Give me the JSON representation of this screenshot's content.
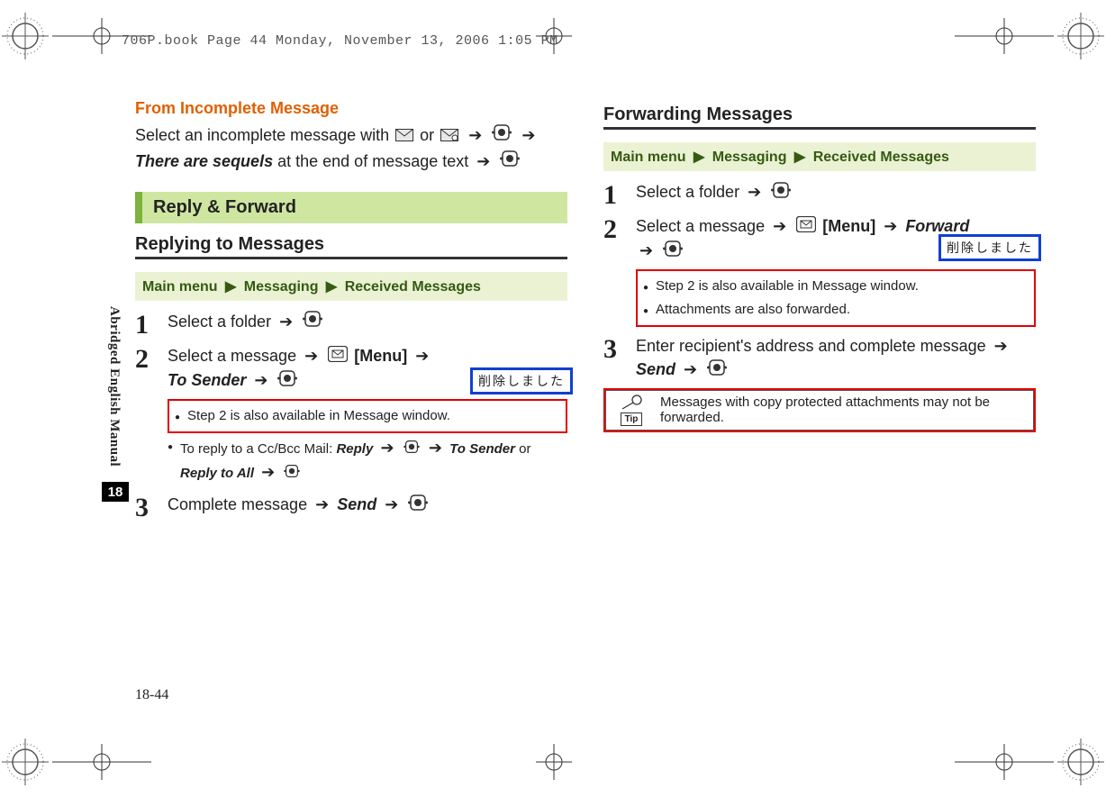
{
  "print_header": "706P.book  Page 44  Monday, November 13, 2006  1:05 PM",
  "sidebar": {
    "label": "Abridged English Manual",
    "chapter": "18",
    "page_num": "18-44"
  },
  "left": {
    "orange_head": "From Incomplete Message",
    "intro_p1a": "Select an incomplete message with ",
    "intro_p1b": " or ",
    "intro_p1c": " ",
    "intro_seq": "There are sequels",
    "intro_tail": " at the end of message text ",
    "greenbar": "Reply & Forward",
    "subhead": "Replying to Messages",
    "crumb": {
      "a": "Main menu",
      "b": "Messaging",
      "c": "Received Messages"
    },
    "step1": "Select a folder ",
    "step2_a": "Select a message ",
    "step2_menu": "[Menu]",
    "step2_b": "To Sender",
    "step2_bullet1": "Step 2 is also available in Message window.",
    "step2_bullet2a": "To reply to a Cc/Bcc Mail: ",
    "step2_bullet2_r": "Reply",
    "step2_bullet2_ts": "To Sender",
    "step2_bullet2_or": " or ",
    "step2_bullet2_ra": "Reply to All",
    "step3_a": "Complete message ",
    "step3_send": "Send",
    "annot": "削除しました"
  },
  "right": {
    "subhead": "Forwarding Messages",
    "crumb": {
      "a": "Main menu",
      "b": "Messaging",
      "c": "Received Messages"
    },
    "step1": "Select a folder ",
    "step2_a": "Select a message ",
    "step2_menu": "[Menu]",
    "step2_fwd": "Forward",
    "step2_bullet1": "Step 2 is also available in Message window.",
    "step2_bullet2": "Attachments are also forwarded.",
    "step3_a": "Enter recipient's address and complete message ",
    "step3_send": "Send",
    "tip_label": "Tip",
    "tip_text": "Messages with copy protected attachments may not be forwarded.",
    "annot": "削除しました"
  }
}
